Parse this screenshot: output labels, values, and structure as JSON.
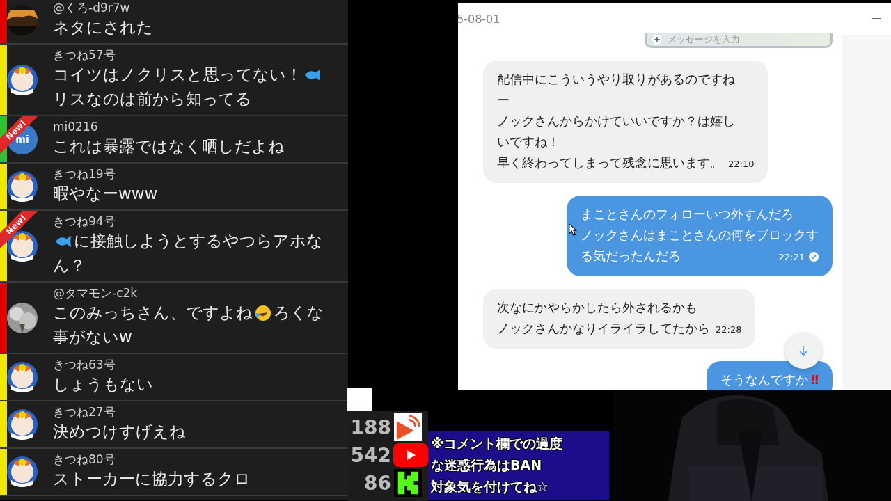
{
  "comments": [
    {
      "name": "@くろ-d9r7w",
      "color": "#e00000",
      "avatar": {
        "kind": "picture"
      },
      "lines": [
        [
          {
            "kind": "text",
            "text": "ネタにされた"
          }
        ]
      ]
    },
    {
      "name": "きつね57号",
      "color": "#f0e800",
      "avatar": {
        "kind": "character"
      },
      "lines": [
        [
          {
            "kind": "text",
            "text": "コイツはノクリスと思ってない！"
          },
          {
            "kind": "fish"
          }
        ],
        [
          {
            "kind": "text",
            "text": "リスなのは前から知ってる"
          }
        ]
      ]
    },
    {
      "name": "mi0216",
      "color": "#30c030",
      "badge": "New!",
      "avatar": {
        "kind": "initials",
        "text": "mi"
      },
      "lines": [
        [
          {
            "kind": "text",
            "text": "これは暴露ではなく晒しだよね"
          }
        ]
      ]
    },
    {
      "name": "きつね19号",
      "color": "#f0e800",
      "avatar": {
        "kind": "character"
      },
      "lines": [
        [
          {
            "kind": "text",
            "text": "暇やなーwww"
          }
        ]
      ]
    },
    {
      "name": "きつね94号",
      "color": "#f0e800",
      "badge": "New!",
      "avatar": {
        "kind": "character"
      },
      "lines": [
        [
          {
            "kind": "fish"
          },
          {
            "kind": "text",
            "text": "に接触しようとするやつらアホな"
          }
        ],
        [
          {
            "kind": "text",
            "text": "ん？"
          }
        ]
      ]
    },
    {
      "name": "@タマモン-c2k",
      "color": "#e00000",
      "avatar": {
        "kind": "picture"
      },
      "lines": [
        [
          {
            "kind": "text",
            "text": "このみっちさん、ですよね"
          },
          {
            "kind": "laugh"
          },
          {
            "kind": "text",
            "text": "ろくな"
          }
        ],
        [
          {
            "kind": "text",
            "text": "事がないw"
          }
        ]
      ]
    },
    {
      "name": "きつね63号",
      "color": "#f0e800",
      "avatar": {
        "kind": "character"
      },
      "lines": [
        [
          {
            "kind": "text",
            "text": "しょうもない"
          }
        ]
      ]
    },
    {
      "name": "きつね27号",
      "color": "#f0e800",
      "avatar": {
        "kind": "character"
      },
      "lines": [
        [
          {
            "kind": "text",
            "text": "決めつけすげえね"
          }
        ]
      ]
    },
    {
      "name": "きつね80号",
      "color": "#f0e800",
      "avatar": {
        "kind": "character"
      },
      "lines": [
        [
          {
            "kind": "text",
            "text": "ストーカーに協力するクロ"
          }
        ]
      ]
    }
  ],
  "chat_window": {
    "date": "5-08-01",
    "input_placeholder": "メッセージを入力",
    "messages": [
      {
        "kind": "incoming",
        "lines": [
          "配信中にこういうやり取りがあるのですね",
          "ー",
          "ノックさんからかけていいですか？は嬉し",
          "いですね！",
          "早く終わってしまって残念に思います。"
        ],
        "time": "22:10"
      },
      {
        "kind": "outgoing",
        "lines": [
          "まことさんのフォローいつ外すんだろ",
          "ノックさんはまことさんの何をブロックす",
          "る気だったんだろ"
        ],
        "time": "22:21",
        "read": true
      },
      {
        "kind": "incoming",
        "lines": [
          "次なにかやらかしたら外されるかも",
          "ノックさんかなりイライラしてたから"
        ],
        "time": "22:28"
      },
      {
        "kind": "outgoing",
        "lines": [
          "そうなんですか"
        ],
        "emphasis": "‼"
      }
    ]
  },
  "viewer_counts": [
    {
      "kind": "cast",
      "count": "188"
    },
    {
      "kind": "video",
      "count": "542"
    },
    {
      "kind": "k",
      "count": "86"
    }
  ],
  "notice": [
    "※コメント欄での過度",
    "な迷惑行為はBAN",
    "対象気を付けてね☆"
  ],
  "camera": {
    "kind": "picture"
  }
}
